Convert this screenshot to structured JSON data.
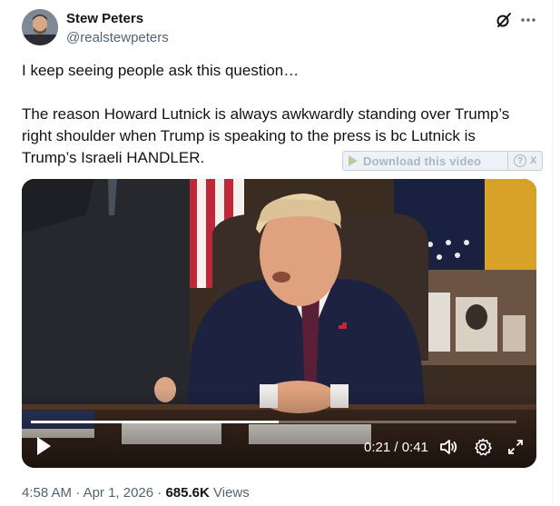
{
  "author": {
    "name": "Stew Peters",
    "handle": "@realstewpeters"
  },
  "header_icons": [
    "grok-icon",
    "more-icon"
  ],
  "tweet": {
    "paragraphs": [
      "I keep seeing people ask this question…",
      "The reason Howard Lutnick is always awkwardly standing over Trump’s right shoulder when Trump is speaking to the press is bc Lutnick is Trump’s Israeli HANDLER."
    ]
  },
  "download_bar": {
    "label": "Download this video",
    "help": "?",
    "close": "X"
  },
  "video": {
    "time": "0:21 / 0:41",
    "progress": 0.51,
    "controls": [
      "play-icon",
      "volume-icon",
      "gear-icon",
      "fullscreen-icon"
    ]
  },
  "meta": {
    "time": "4:58 AM",
    "date": "Apr 1, 2026",
    "separator": "·",
    "views_count": "685.6K",
    "views_label": "Views"
  },
  "colors": {
    "text": "#0f1419",
    "secondary": "#536471",
    "border": "#eff3f4"
  }
}
